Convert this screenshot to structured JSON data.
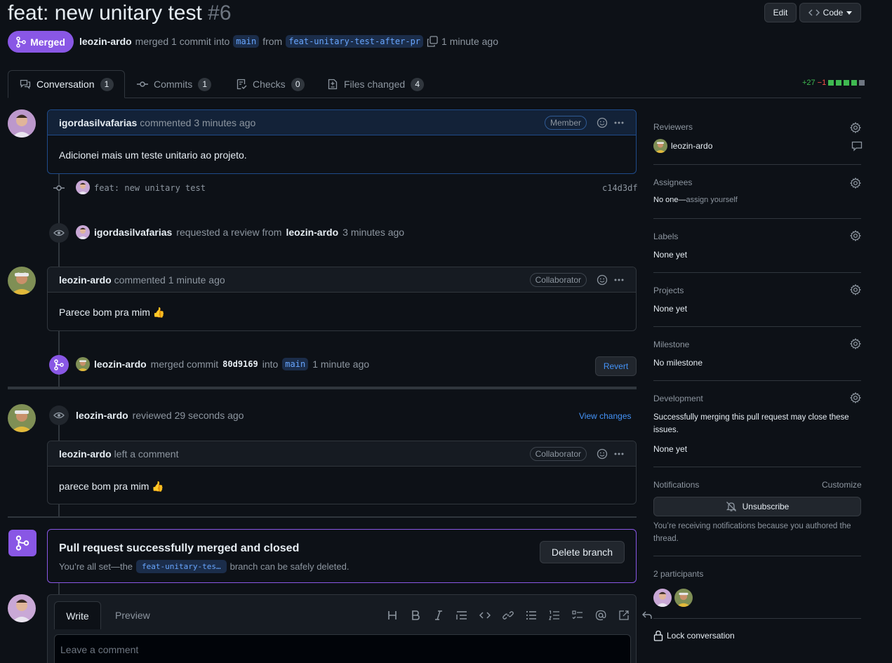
{
  "pr": {
    "title": "feat: new unitary test",
    "number": "#6",
    "status": "Merged",
    "author": "leozin-ardo",
    "merge_text": "merged 1 commit into",
    "base_branch": "main",
    "from_text": "from",
    "head_branch": "feat-unitary-test-after-pr",
    "time": "1 minute ago"
  },
  "header_buttons": {
    "edit": "Edit",
    "code": "Code"
  },
  "tabs": [
    {
      "label": "Conversation",
      "count": "1"
    },
    {
      "label": "Commits",
      "count": "1"
    },
    {
      "label": "Checks",
      "count": "0"
    },
    {
      "label": "Files changed",
      "count": "4"
    }
  ],
  "diffstat": {
    "additions": "+27",
    "deletions": "−1"
  },
  "timeline": {
    "comment1": {
      "author": "igordasilvafarias",
      "action": "commented 3 minutes ago",
      "role": "Member",
      "body": "Adicionei mais um teste unitario ao projeto."
    },
    "commit": {
      "message": "feat: new unitary test",
      "sha": "c14d3df"
    },
    "review_request": {
      "author": "igordasilvafarias",
      "text1": "requested a review from",
      "reviewer": "leozin-ardo",
      "time": "3 minutes ago"
    },
    "comment2": {
      "author": "leozin-ardo",
      "action": "commented 1 minute ago",
      "role": "Collaborator",
      "body": "Parece bom pra mim 👍"
    },
    "merge_event": {
      "author": "leozin-ardo",
      "text1": "merged commit",
      "sha": "80d9169",
      "text2": "into",
      "branch": "main",
      "time": "1 minute ago",
      "revert": "Revert"
    },
    "review": {
      "author": "leozin-ardo",
      "action": "reviewed 29 seconds ago",
      "view_changes": "View changes"
    },
    "review_comment": {
      "author": "leozin-ardo",
      "action": "left a comment",
      "role": "Collaborator",
      "body": "parece bom pra mim 👍"
    },
    "merged_box": {
      "title": "Pull request successfully merged and closed",
      "text1": "You’re all set—the",
      "branch": "feat-unitary-tes…",
      "text2": "branch can be safely deleted.",
      "delete_button": "Delete branch"
    },
    "editor": {
      "write_tab": "Write",
      "preview_tab": "Preview",
      "placeholder": "Leave a comment"
    }
  },
  "sidebar": {
    "reviewers": {
      "label": "Reviewers",
      "value": "leozin-ardo"
    },
    "assignees": {
      "label": "Assignees",
      "value_bold": "No one—",
      "value_link": "assign yourself"
    },
    "labels": {
      "label": "Labels",
      "value": "None yet"
    },
    "projects": {
      "label": "Projects",
      "value": "None yet"
    },
    "milestone": {
      "label": "Milestone",
      "value": "No milestone"
    },
    "development": {
      "label": "Development",
      "text": "Successfully merging this pull request may close these issues.",
      "value": "None yet"
    },
    "notifications": {
      "label": "Notifications",
      "customize": "Customize",
      "unsubscribe": "Unsubscribe",
      "note": "You’re receiving notifications because you authored the thread."
    },
    "participants": {
      "label": "2 participants"
    },
    "lock": "Lock conversation"
  },
  "colors": {
    "merged": "#8957e5",
    "link": "#4493f8",
    "additions": "#3fb950",
    "deletions": "#f85149"
  }
}
